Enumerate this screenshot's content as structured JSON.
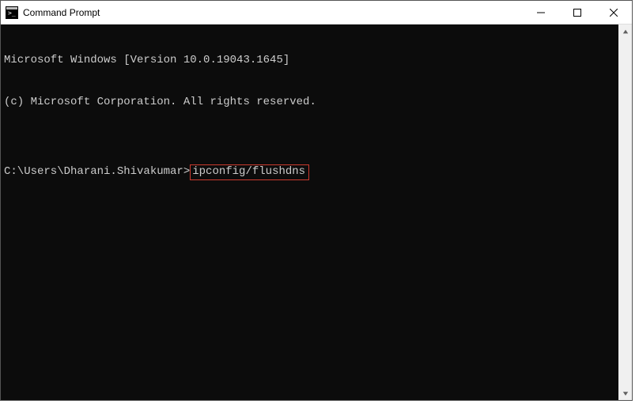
{
  "window": {
    "title": "Command Prompt"
  },
  "terminal": {
    "line1": "Microsoft Windows [Version 10.0.19043.1645]",
    "line2": "(c) Microsoft Corporation. All rights reserved.",
    "blank": "",
    "prompt": "C:\\Users\\Dharani.Shivakumar>",
    "command": "ipconfig/flushdns"
  }
}
